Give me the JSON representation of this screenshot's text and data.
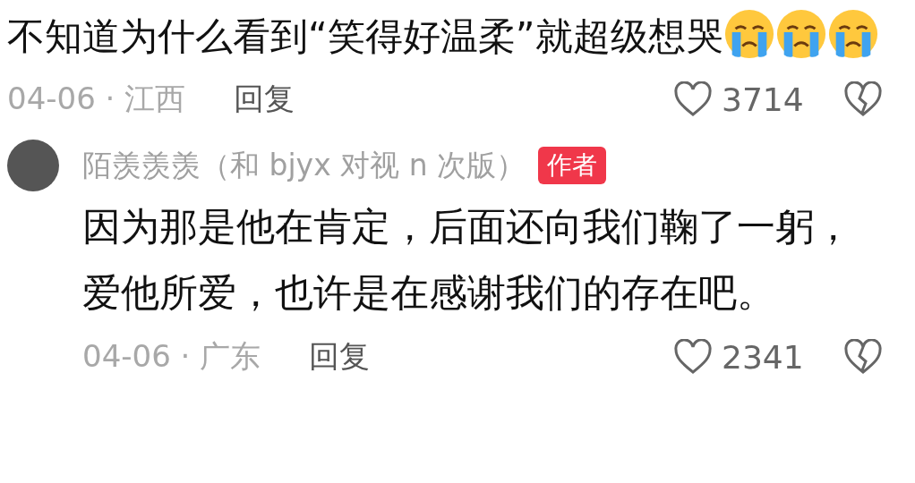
{
  "comments": [
    {
      "text": "不知道为什么看到“笑得好温柔”就超级想哭",
      "emojis": [
        {
          "kind": "crying"
        },
        {
          "kind": "crying"
        },
        {
          "kind": "crying"
        }
      ],
      "date": "04-06",
      "separator": "·",
      "location": "江西",
      "reply_label": "回复",
      "likes": "3714",
      "liked": false
    },
    {
      "author": "陌羡羡羡（和 bjyx 对视 n 次版）",
      "badge": "作者",
      "text": "因为那是他在肯定，后面还向我们鞠了一躬，爱他所爱，也许是在感谢我们的存在吧。",
      "date": "04-06",
      "separator": "·",
      "location": "广东",
      "reply_label": "回复",
      "likes": "2341",
      "liked": false
    }
  ]
}
